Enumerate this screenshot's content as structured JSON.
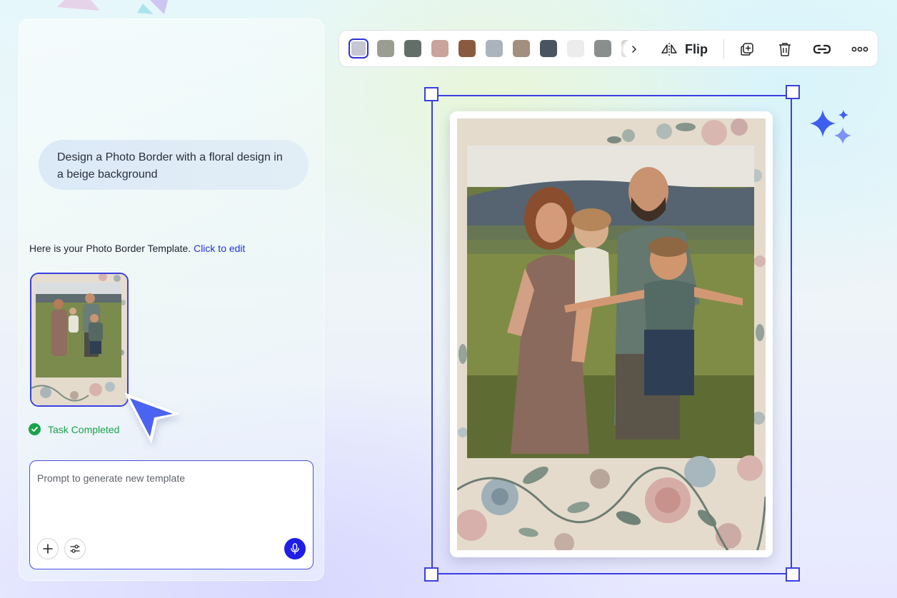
{
  "chat": {
    "user_prompt": "Design a Photo Border with a floral design in a beige background",
    "assistant_message": "Here is your Photo Border Template.",
    "assistant_link": "Click to edit",
    "task_status": "Task Completed",
    "prompt_placeholder": "Prompt to generate new template"
  },
  "toolbar": {
    "swatches": [
      "#c6c7d2",
      "#9a9d93",
      "#646e69",
      "#caa39a",
      "#8a5a40",
      "#abb3bc",
      "#a38f7f",
      "#4a5460",
      "#ececec",
      "#888f8c",
      "#a39a88"
    ],
    "selected_swatch": 0,
    "flip_label": "Flip",
    "icons": [
      "chevron-right-icon",
      "flip-icon",
      "duplicate-icon",
      "trash-icon",
      "link-icon",
      "more-icon"
    ]
  },
  "colors": {
    "accent": "#3b3fe0",
    "mic_button": "#1e1ee8",
    "success": "#1aa34a",
    "link": "#2233d6"
  }
}
